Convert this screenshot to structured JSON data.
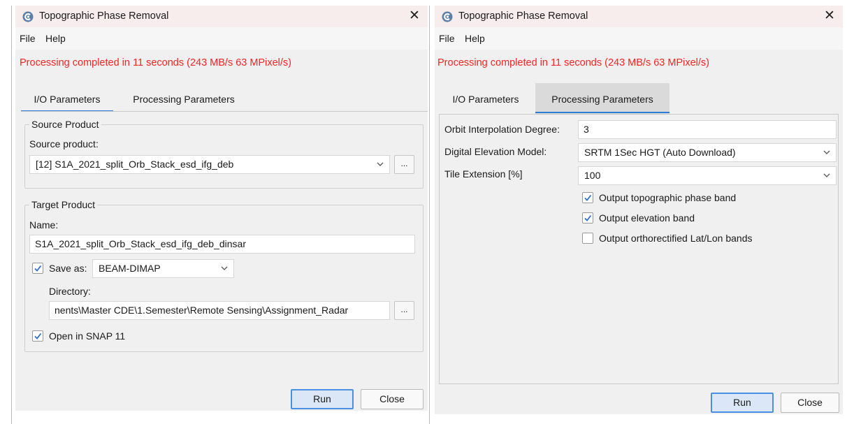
{
  "window_title": "Topographic Phase Removal",
  "menu": {
    "file": "File",
    "help": "Help"
  },
  "status": "Processing completed in 11 seconds (243 MB/s 63 MPixel/s)",
  "tabs": {
    "io": "I/O Parameters",
    "processing": "Processing Parameters"
  },
  "left": {
    "active_tab": "I/O Parameters",
    "source_group": "Source Product",
    "source_label": "Source product:",
    "source_value": "[12] S1A_2021_split_Orb_Stack_esd_ifg_deb",
    "target_group": "Target Product",
    "name_label": "Name:",
    "name_value": "S1A_2021_split_Orb_Stack_esd_ifg_deb_dinsar",
    "save_as_label": "Save as:",
    "save_as_checked": true,
    "format_value": "BEAM-DIMAP",
    "directory_label": "Directory:",
    "directory_value": "nents\\Master CDE\\1.Semester\\Remote Sensing\\Assignment_Radar",
    "open_in_snap_label": "Open in SNAP 11",
    "open_in_snap_checked": true,
    "browse_label": "..."
  },
  "right": {
    "active_tab": "Processing Parameters",
    "orbit_label": "Orbit Interpolation Degree:",
    "orbit_value": "3",
    "dem_label": "Digital Elevation Model:",
    "dem_value": "SRTM 1Sec HGT (Auto Download)",
    "tile_label": "Tile Extension [%]",
    "tile_value": "100",
    "checkboxes": [
      {
        "label": "Output topographic phase band",
        "checked": true
      },
      {
        "label": "Output elevation band",
        "checked": true
      },
      {
        "label": "Output orthorectified Lat/Lon bands",
        "checked": false
      }
    ]
  },
  "buttons": {
    "run": "Run",
    "close": "Close"
  },
  "colors": {
    "status": "#ff2222",
    "accent": "#2d7fd6",
    "run_border": "#4a90e2"
  },
  "icons": {
    "app": "snap-app-icon",
    "close": "close-icon",
    "dropdown": "chevron-down-icon",
    "check": "check-icon"
  }
}
